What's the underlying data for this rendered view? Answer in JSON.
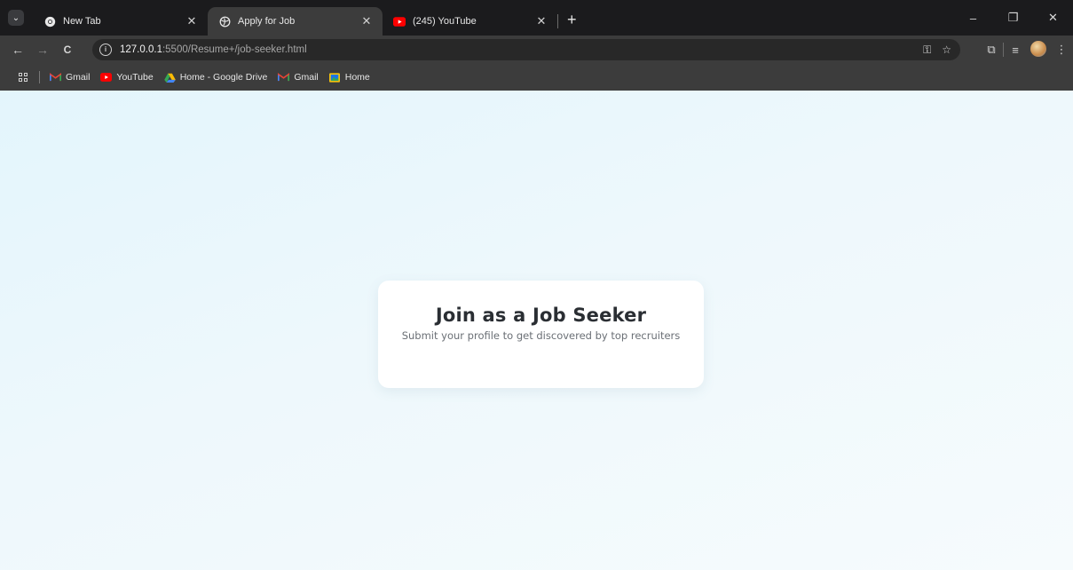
{
  "browser": {
    "tabs": [
      {
        "title": "New Tab",
        "active": false,
        "icon": "chrome-icon"
      },
      {
        "title": "Apply for Job",
        "active": true,
        "icon": "globe-icon"
      },
      {
        "title": "(245) YouTube",
        "active": false,
        "icon": "youtube-icon"
      }
    ],
    "new_tab_symbol": "+",
    "window_controls": {
      "minimize": "–",
      "restore": "❐",
      "close": "✕"
    },
    "nav": {
      "back": "←",
      "forward": "→",
      "reload": "C"
    },
    "address": {
      "host": "127.0.0.1",
      "path": ":5500/Resume+/job-seeker.html"
    },
    "bookmarks": [
      {
        "label": "Gmail",
        "icon": "gmail-icon"
      },
      {
        "label": "YouTube",
        "icon": "youtube-icon"
      },
      {
        "label": "Home - Google Drive",
        "icon": "drive-icon"
      },
      {
        "label": "Gmail",
        "icon": "gmail-icon"
      },
      {
        "label": "Home",
        "icon": "home-image-icon"
      }
    ]
  },
  "page": {
    "heading": "Join as a Job Seeker",
    "subheading": "Submit your profile to get discovered by top recruiters"
  },
  "colors": {
    "tabstrip": "#1b1b1d",
    "toolbar": "#3c3c3c",
    "page_bg": "#e8f7fc",
    "card_bg": "#ffffff",
    "heading": "#2a2e33",
    "youtube_red": "#ff0000"
  }
}
